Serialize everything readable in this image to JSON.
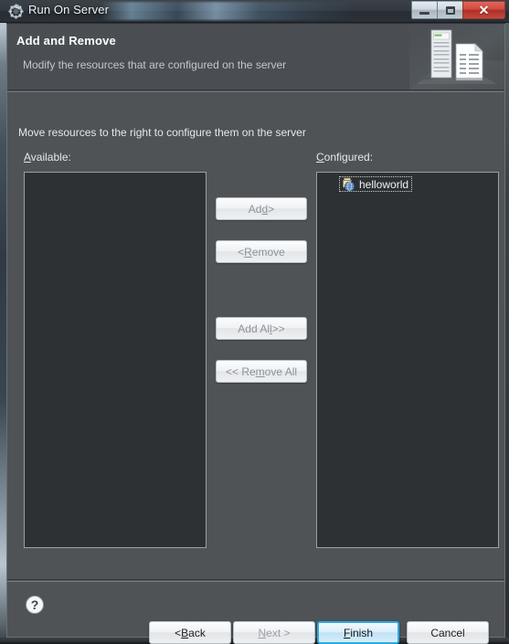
{
  "window": {
    "title": "Run On Server",
    "icon": "gear-icon",
    "controls": {
      "minimize": "minimize-icon",
      "maximize": "maximize-icon",
      "close": "✕"
    }
  },
  "header": {
    "title": "Add and Remove",
    "description": "Modify the resources that are configured on the server",
    "banner_icon": "server-and-document-icon"
  },
  "content": {
    "instruction": "Move resources to the right to configure them on the server",
    "available": {
      "label_pre": "",
      "label_mnemonic": "A",
      "label_post": "vailable:",
      "items": []
    },
    "configured": {
      "label_pre": "",
      "label_mnemonic": "C",
      "label_post": "onfigured:",
      "items": [
        {
          "label": "helloworld",
          "icon": "web-module-icon",
          "selected": true
        }
      ]
    }
  },
  "transfer_buttons": [
    {
      "name": "add-button",
      "pre": "Ad",
      "mnemonic": "d",
      "post": " >",
      "enabled": false
    },
    {
      "name": "remove-button",
      "pre": "< ",
      "mnemonic": "R",
      "post": "emove",
      "enabled": false
    },
    {
      "name": "add-all-button",
      "pre": "Add Al",
      "mnemonic": "l",
      "post": " >>",
      "enabled": false
    },
    {
      "name": "remove-all-button",
      "pre": "<< Re",
      "mnemonic": "m",
      "post": "ove All",
      "enabled": false
    }
  ],
  "footer": {
    "help_icon": "help-question-icon",
    "buttons": [
      {
        "name": "back-button",
        "pre": "< ",
        "mnemonic": "B",
        "post": "ack",
        "enabled": true,
        "default": false
      },
      {
        "name": "next-button",
        "pre": "",
        "mnemonic": "N",
        "post": "ext >",
        "enabled": false,
        "default": false
      },
      {
        "name": "finish-button",
        "pre": "",
        "mnemonic": "F",
        "post": "inish",
        "enabled": true,
        "default": true
      },
      {
        "name": "cancel-button",
        "pre": "Cancel",
        "mnemonic": "",
        "post": "",
        "enabled": true,
        "default": false
      }
    ]
  },
  "colors": {
    "dialog_bg": "#4f5356",
    "header_bg": "#4a4e52",
    "list_bg": "#2e3134",
    "text": "#e3e8ea",
    "accent": "#2fa8e0",
    "close_red": "#cf4a3e"
  }
}
